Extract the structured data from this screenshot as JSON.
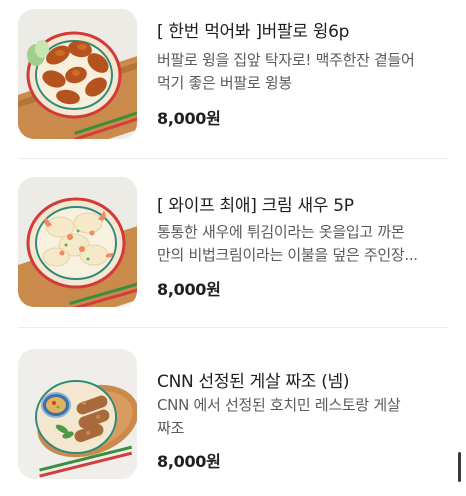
{
  "menu": {
    "items": [
      {
        "title": "[ 한번 먹어봐 ]버팔로 윙6p",
        "desc": [
          "버팔로 윙을 집앞 탁자로! 맥주한잔 곁들어",
          "먹기 좋은 버팔로 윙봉"
        ],
        "price": "8,000원",
        "image_icon": "buffalo-wings-photo"
      },
      {
        "title": "[ 와이프 최애] 크림 새우 5P",
        "desc": [
          "통통한 새우에 튀김이라는 옷을입고 까몬",
          "만의 비법크림이라는 이불을 덮은 주인장..."
        ],
        "price": "8,000원",
        "image_icon": "cream-shrimp-photo"
      },
      {
        "title": "CNN 선정된 게살 짜조 (넴)",
        "desc": [
          "CNN 에서 선정된 호치민 레스토랑 게살",
          "짜조"
        ],
        "price": "8,000원",
        "image_icon": "crab-spring-roll-photo"
      }
    ]
  },
  "colors": {
    "title": "#1f1f1f",
    "description": "#5b5b5b",
    "divider": "#ececec"
  }
}
